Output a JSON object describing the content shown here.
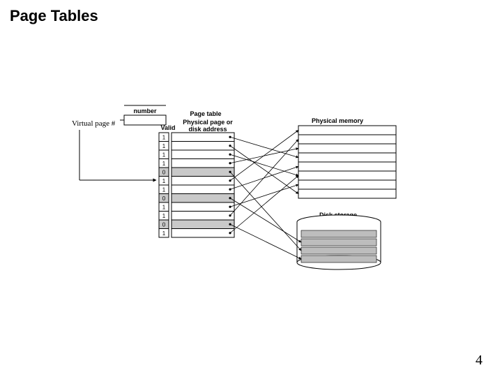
{
  "title": "Page Tables",
  "page_number": "4",
  "labels": {
    "virtual_page": "Virtual page #",
    "ptr_top": "number",
    "table_header": "Page table",
    "valid": "Valid",
    "ppn": "Physical page or\ndisk address",
    "phys_mem": "Physical memory",
    "disk": "Disk storage"
  },
  "page_table": {
    "valid_bits": [
      "1",
      "1",
      "1",
      "1",
      "0",
      "1",
      "1",
      "0",
      "1",
      "1",
      "0",
      "1"
    ],
    "shaded": [
      0,
      0,
      0,
      0,
      1,
      0,
      0,
      1,
      0,
      0,
      1,
      0
    ]
  },
  "phys_mem": {
    "rows": 8
  },
  "disk": {
    "slots": 4
  },
  "chart_data": {
    "type": "diagram",
    "note": "Virtual memory page-table mapping",
    "page_table_valid": [
      1,
      1,
      1,
      1,
      0,
      1,
      1,
      0,
      1,
      1,
      0,
      1
    ],
    "valid_to_physical_row": {
      "0": 3,
      "1": 7,
      "2": 5,
      "3": 2,
      "5": 0,
      "6": 4,
      "8": 6,
      "9": 1,
      "11": 5
    },
    "invalid_to_disk_slot": {
      "4": 2,
      "7": 1,
      "10": 3
    }
  }
}
